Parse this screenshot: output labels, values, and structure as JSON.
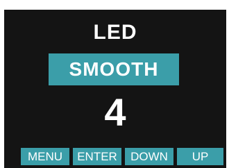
{
  "display": {
    "title": "LED",
    "mode": "SMOOTH",
    "value": "4"
  },
  "softkeys": {
    "menu": "MENU",
    "enter": "ENTER",
    "down": "DOWN",
    "up": "UP"
  },
  "colors": {
    "background": "#141414",
    "accent": "#3b9ea9",
    "text": "#ffffff"
  }
}
